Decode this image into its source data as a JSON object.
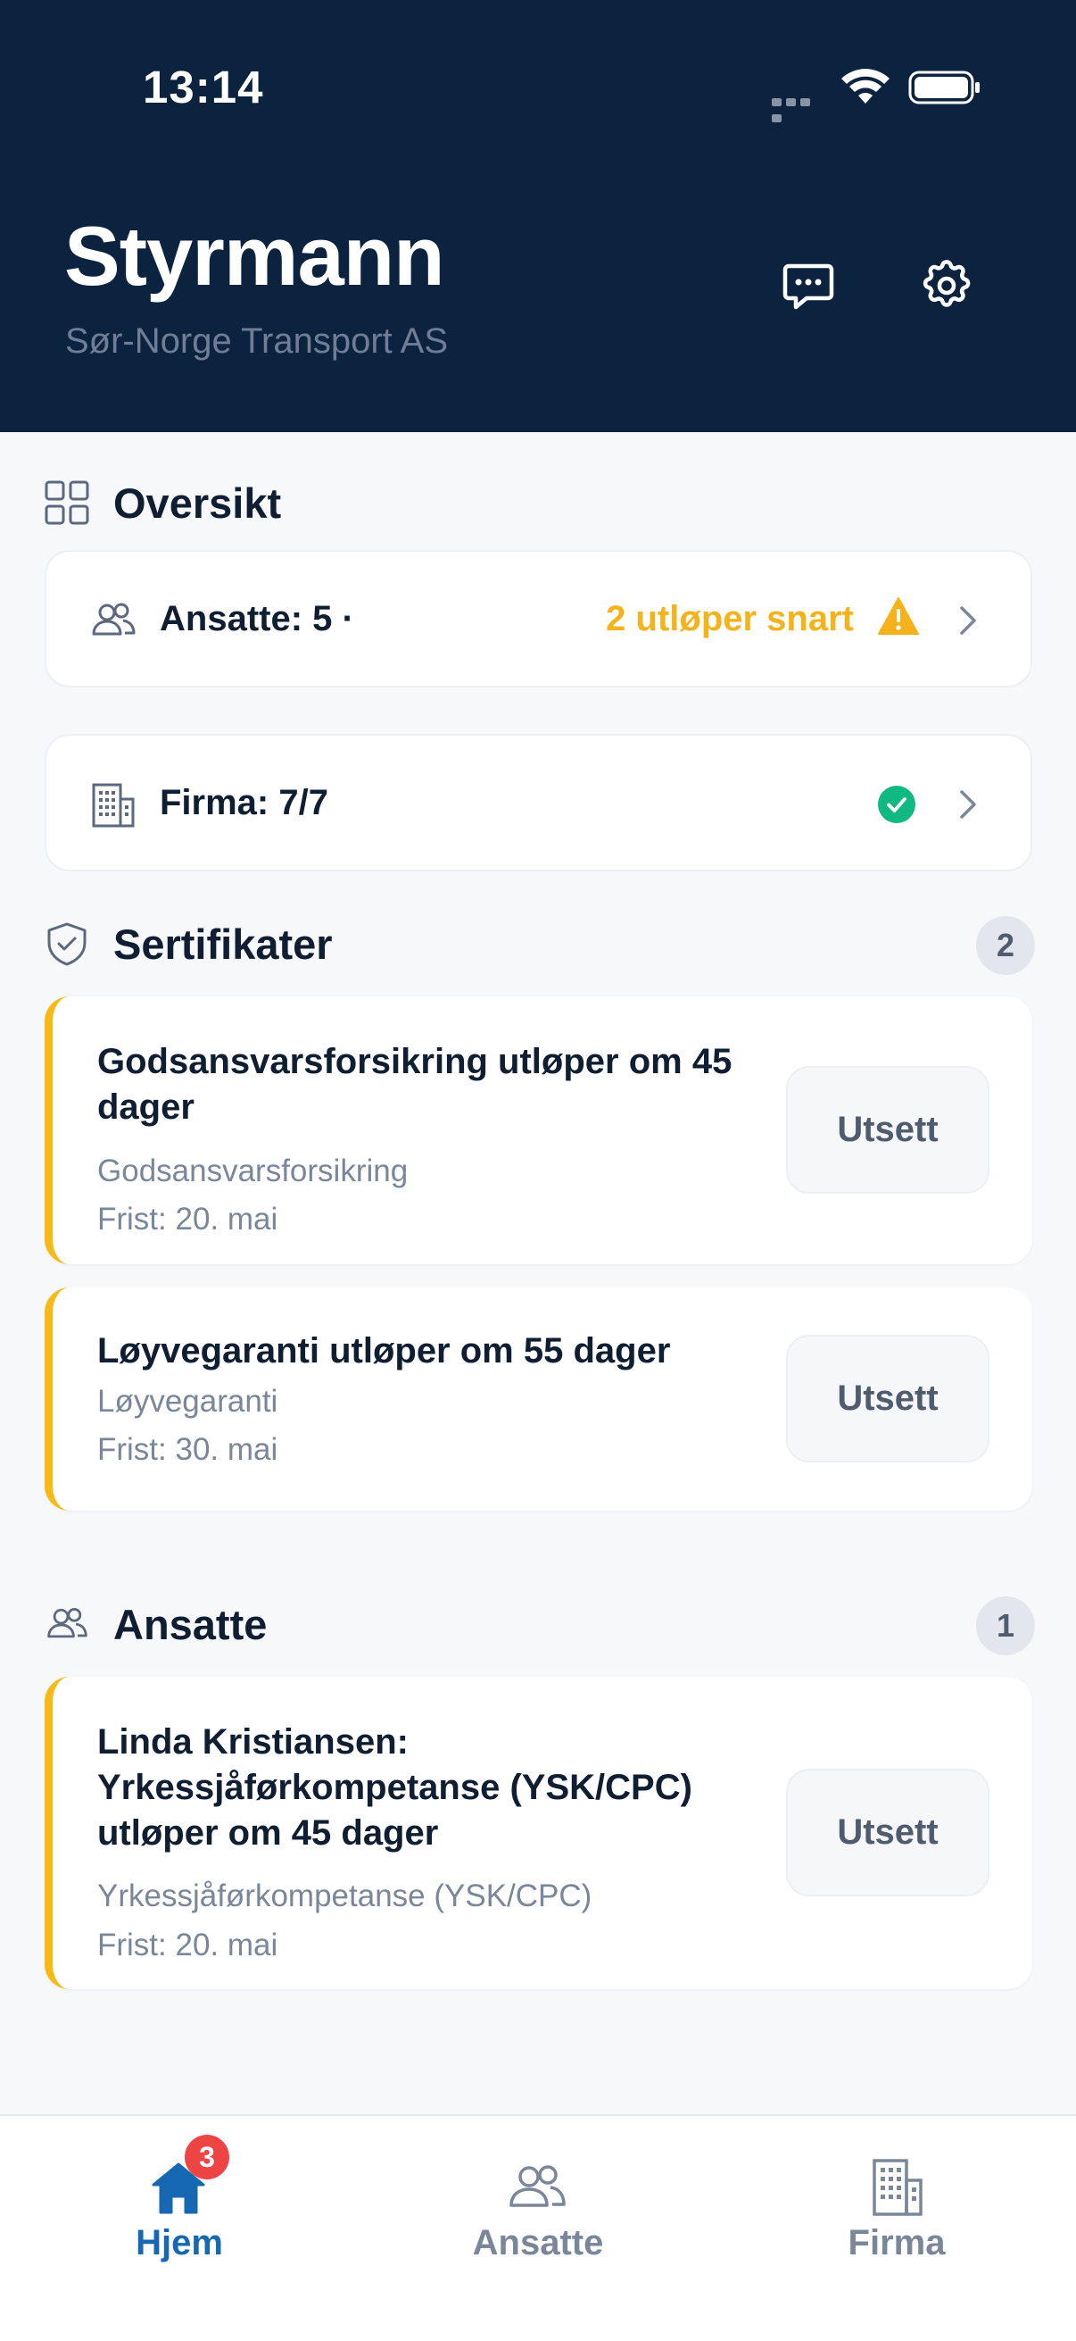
{
  "status_bar": {
    "time": "13:14"
  },
  "header": {
    "title": "Styrmann",
    "subtitle": "Sør-Norge Transport AS",
    "chat_icon": "chat-bubble-icon",
    "settings_icon": "gear-icon"
  },
  "overview": {
    "title": "Oversikt",
    "employees_label": "Ansatte: 5 ·",
    "employees_warning": "2 utløper snart",
    "company_label": "Firma: 7/7"
  },
  "certificates": {
    "title": "Sertifikater",
    "count": "2",
    "items": [
      {
        "title": "Godsansvarsforsikring utløper om 45 dager",
        "category": "Godsansvarsforsikring",
        "due": "Frist: 20. mai",
        "action": "Utsett"
      },
      {
        "title": "Løyvegaranti utløper om 55 dager",
        "category": "Løyvegaranti",
        "due": "Frist: 30. mai",
        "action": "Utsett"
      }
    ]
  },
  "employees": {
    "title": "Ansatte",
    "count": "1",
    "items": [
      {
        "title": "Linda Kristiansen: Yrkessjåførkompetanse (YSK/CPC) utløper om 45 dager",
        "category": "Yrkessjåførkompetanse (YSK/CPC)",
        "due": "Frist: 20. mai",
        "action": "Utsett"
      }
    ]
  },
  "tabbar": {
    "tabs": [
      {
        "label": "Hjem",
        "badge": "3",
        "active": true
      },
      {
        "label": "Ansatte",
        "active": false
      },
      {
        "label": "Firma",
        "active": false
      }
    ]
  },
  "colors": {
    "header_bg": "#0c2340",
    "accent_blue": "#1668b3",
    "warning": "#f5b21b",
    "success": "#10b981",
    "badge_red": "#ef4444"
  }
}
